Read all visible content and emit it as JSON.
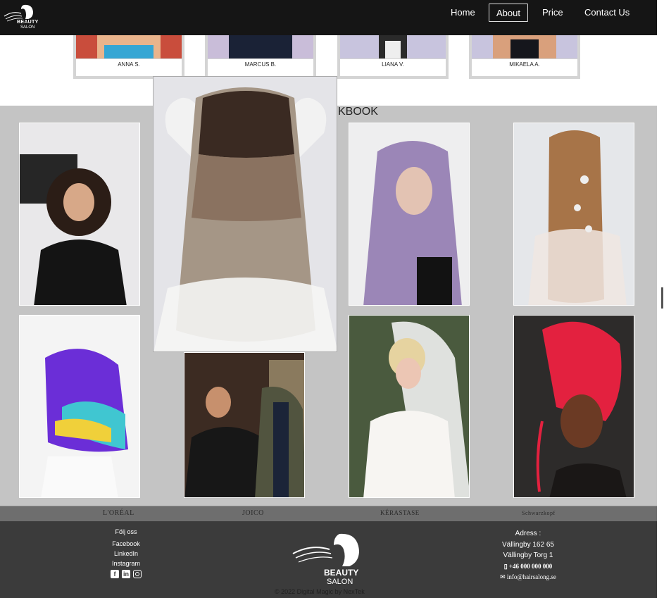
{
  "brand": {
    "logo_line1": "BEAUTY",
    "logo_line2": "SALON"
  },
  "nav": {
    "items": [
      {
        "label": "Home"
      },
      {
        "label": "About"
      },
      {
        "label": "Price"
      },
      {
        "label": "Contact Us"
      }
    ],
    "active": "About"
  },
  "team": {
    "members": [
      {
        "name": "ANNA S."
      },
      {
        "name": "MARCUS B."
      },
      {
        "name": "LIANA V."
      },
      {
        "name": "MIKAELA A."
      }
    ]
  },
  "gallery": {
    "title_visible": "KBOOK",
    "images": [
      {
        "subject": "curly-dark-hair-woman"
      },
      {
        "subject": "lavender-long-hair-woman"
      },
      {
        "subject": "bridal-updo-back"
      },
      {
        "subject": "rainbow-hair-woman"
      },
      {
        "subject": "barber-styling-man"
      },
      {
        "subject": "bride-veil"
      },
      {
        "subject": "red-braids-woman"
      }
    ],
    "popup_subject": "ombre-wavy-hair-back"
  },
  "brands": {
    "items": [
      "L'ORÉAL",
      "JOICO",
      "KÉRASTASE",
      "Schwarzkopf"
    ]
  },
  "footer": {
    "social": {
      "title": "Följ oss",
      "links": [
        "Facebook",
        "LinkedIn",
        "Instagram"
      ]
    },
    "logo": {
      "line1": "BEAUTY",
      "line2": "SALON"
    },
    "address": {
      "title": "Adress :",
      "line1": "Vällingby 162 65",
      "line2": "Vällingby Torg 1",
      "phone": "+46 000 000 000",
      "email": "info@hairsalong.se"
    },
    "copyright": "© 2022 Digital Magic by NexTek"
  },
  "colors": {
    "nav_bg": "#151515",
    "gallery_bg": "#c4c4c4",
    "footer_bg": "#3b3b3b",
    "brands_bg": "#6e6e6e"
  },
  "icons": [
    "facebook-icon",
    "linkedin-icon",
    "instagram-icon",
    "phone-icon",
    "mail-icon"
  ]
}
